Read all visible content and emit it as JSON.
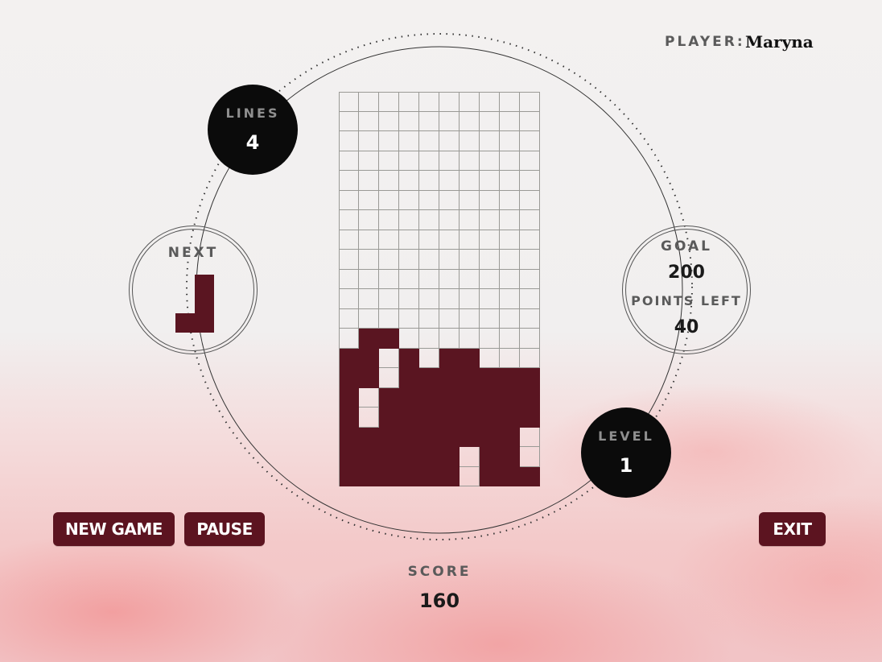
{
  "player": {
    "label": "PLAYER:",
    "name": "Maryna"
  },
  "lines": {
    "label": "LINES",
    "value": "4"
  },
  "next": {
    "label": "NEXT",
    "piece": "J"
  },
  "goal": {
    "label": "GOAL",
    "value": "200",
    "points_left_label": "POINTS LEFT",
    "points_left_value": "40"
  },
  "level": {
    "label": "LEVEL",
    "value": "1"
  },
  "score": {
    "label": "SCORE",
    "value": "160"
  },
  "buttons": {
    "new_game": "NEW GAME",
    "pause": "PAUSE",
    "exit": "EXIT"
  },
  "board": {
    "columns": 10,
    "rows": 20,
    "cells": [
      "..........",
      "..........",
      "..........",
      "..........",
      "..........",
      "..........",
      "..........",
      "..........",
      "..........",
      "..........",
      "..........",
      "..........",
      ".##.......",
      "##.#.##...",
      "##.#######",
      "#.########",
      "#.########",
      "#########.",
      "######.##.",
      "######.###"
    ]
  },
  "colors": {
    "block": "#5a1521",
    "accent": "#5c1420",
    "bubble": "#0b0b0b"
  }
}
